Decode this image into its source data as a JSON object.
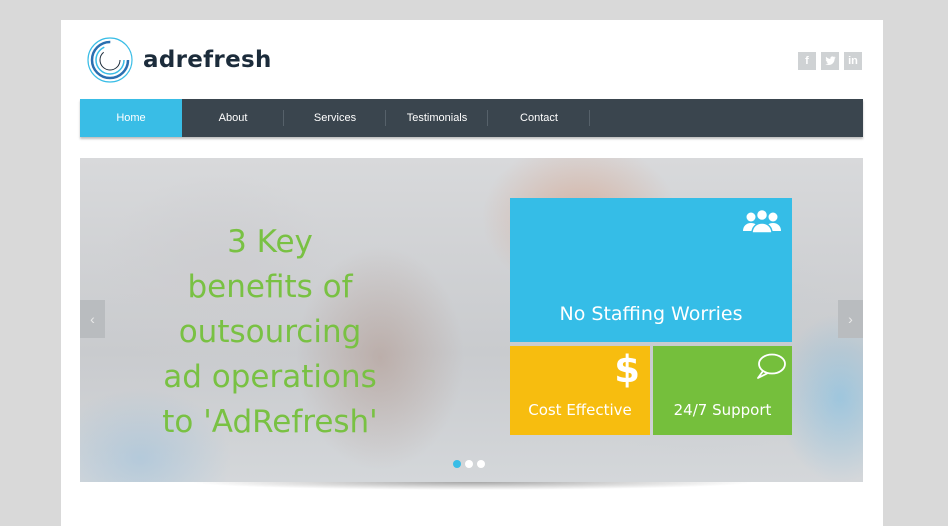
{
  "brand": {
    "name": "adrefresh"
  },
  "social": [
    {
      "icon": "facebook-icon",
      "glyph": "f"
    },
    {
      "icon": "twitter-icon",
      "glyph": "t"
    },
    {
      "icon": "linkedin-icon",
      "glyph": "in"
    }
  ],
  "nav": {
    "items": [
      {
        "label": "Home",
        "active": true
      },
      {
        "label": "About",
        "active": false
      },
      {
        "label": "Services",
        "active": false
      },
      {
        "label": "Testimonials",
        "active": false
      },
      {
        "label": "Contact",
        "active": false
      }
    ]
  },
  "hero": {
    "headline": "3 Key benefits of outsourcing ad operations to 'AdRefresh'",
    "tiles": {
      "staffing": {
        "label": "No Staffing Worries",
        "icon": "people-icon",
        "color": "#35bde7"
      },
      "cost": {
        "label": "Cost Effective",
        "icon": "dollar-icon",
        "symbol": "$",
        "color": "#f7bd0f"
      },
      "support": {
        "label": "24/7 Support",
        "icon": "chat-bubble-icon",
        "color": "#75bf3c"
      }
    },
    "prev_arrow": "‹",
    "next_arrow": "›",
    "slides": 3,
    "active_slide": 1
  },
  "colors": {
    "accent": "#39bde6",
    "nav_bg": "#3a454e",
    "headline": "#79c143"
  }
}
